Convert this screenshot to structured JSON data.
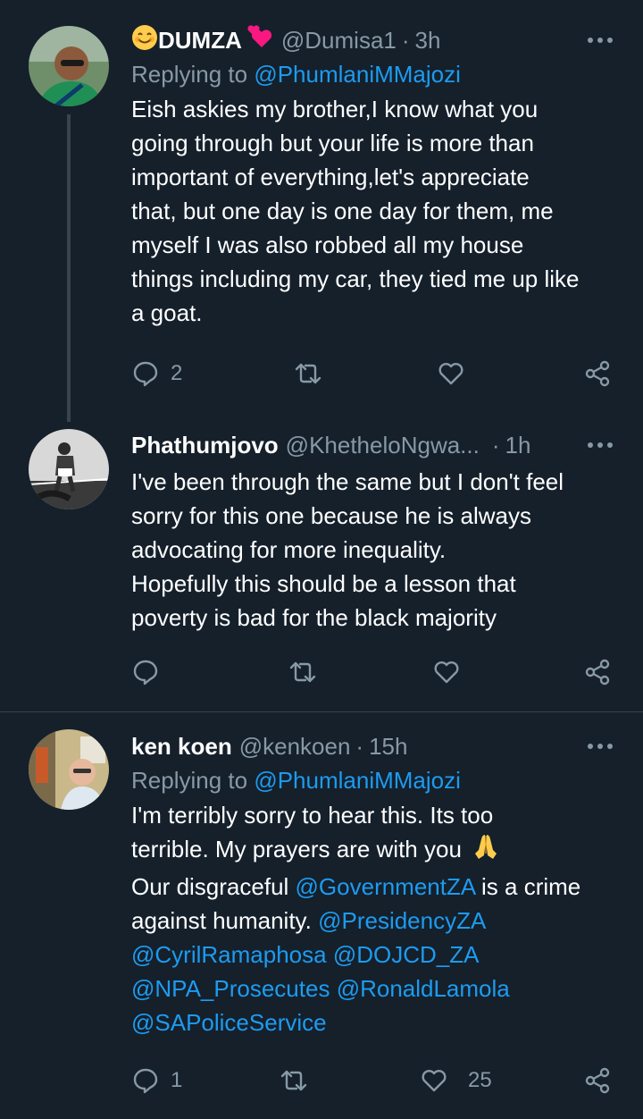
{
  "tweets": [
    {
      "display_name": "DUMZA",
      "handle": "@Dumisa1",
      "time": "3h",
      "replying_prefix": "Replying to",
      "replying_to": "@PhumlaniMMajozi",
      "text": "Eish askies my brother,I know what you\ngoing through but your life is more than\nimportant of everything,let's appreciate\nthat, but one day is one day for them, me\nmyself I was also robbed all my house\nthings including my car, they tied me up like\na goat.",
      "reply_count": "2",
      "retweet_count": "",
      "like_count": ""
    },
    {
      "display_name": "Phathumjovo",
      "handle": "@KhetheloNgwa...",
      "time": "1h",
      "text": "I've been through the same but I don't feel\nsorry for this one because he is always\nadvocating for more inequality.\nHopefully this should be a lesson that\npoverty is bad for the black majority",
      "reply_count": "",
      "retweet_count": "",
      "like_count": ""
    },
    {
      "display_name": "ken koen",
      "handle": "@kenkoen",
      "time": "15h",
      "replying_prefix": "Replying to",
      "replying_to": "@PhumlaniMMajozi",
      "text_line1": "I'm terribly sorry to hear this. Its too",
      "text_line2": "terrible. My prayers are with you",
      "text_line3_prefix": "Our disgraceful ",
      "mention_gov": "@GovernmentZA",
      "text_line3_suffix": " is a crime",
      "text_line4_prefix": "against humanity. ",
      "mention_presidency": "@PresidencyZA",
      "mention_cyril": "@CyrilRamaphosa",
      "mention_dojcd": "@DOJCD_ZA",
      "mention_npa": "@NPA_Prosecutes",
      "mention_lamola": "@RonaldLamola",
      "mention_saps": "@SAPoliceService",
      "reply_count": "1",
      "retweet_count": "",
      "like_count": "25"
    }
  ],
  "colors": {
    "background": "#15202b",
    "mention": "#1d9bf0",
    "secondary_text": "#8899a6",
    "divider": "#38444d"
  },
  "icons": [
    "reply-icon",
    "retweet-icon",
    "like-icon",
    "share-icon",
    "more-icon",
    "smiling-face-emoji",
    "hearts-emoji",
    "praying-hands-emoji"
  ]
}
